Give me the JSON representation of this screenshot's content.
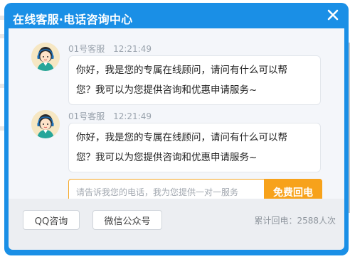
{
  "header": {
    "title": "在线客服·电话咨询中心",
    "close_icon": "close-icon"
  },
  "messages": [
    {
      "sender": "01号客服",
      "time": "12:21:49",
      "text_line1": "你好，我是您的专属在线顾问，请问有什么可以帮",
      "text_line2": "您？我可以为您提供咨询和优惠申请服务~"
    },
    {
      "sender": "01号客服",
      "time": "12:21:49",
      "text_line1": "你好，我是您的专属在线顾问，请问有什么可以帮",
      "text_line2": "您？我可以为您提供咨询和优惠申请服务~"
    }
  ],
  "callback": {
    "placeholder": "请告诉我您的电话，我为您提供一对一服务",
    "value": "",
    "button_label": "免费回电"
  },
  "footer": {
    "qq_label": "QQ咨询",
    "wechat_label": "微信公众号",
    "total": "累计回电：2588人次"
  },
  "colors": {
    "header_blue": "#1a8fe6",
    "accent_orange": "#f7a21b"
  }
}
